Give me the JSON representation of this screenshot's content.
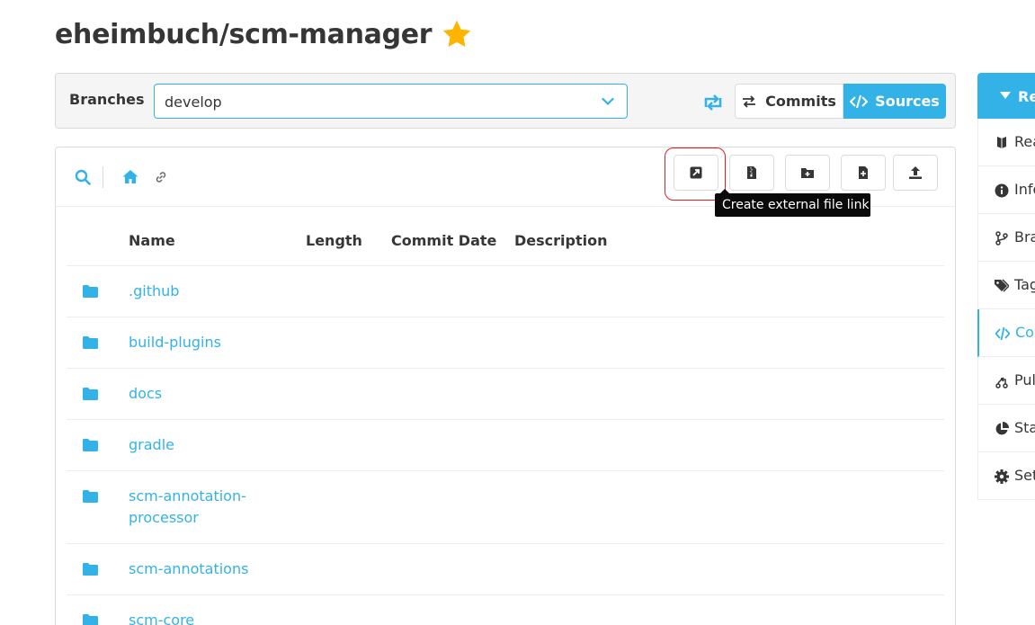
{
  "repo": {
    "title": "eheimbuch/scm-manager"
  },
  "branch_bar": {
    "label": "Branches",
    "selected_branch": "develop",
    "commits_label": "Commits",
    "sources_label": "Sources"
  },
  "toolbar": {
    "tooltip": "Create external file link"
  },
  "table": {
    "headers": [
      "Name",
      "Length",
      "Commit Date",
      "Description"
    ],
    "rows": [
      {
        "name": ".github"
      },
      {
        "name": "build-plugins"
      },
      {
        "name": "docs"
      },
      {
        "name": "gradle"
      },
      {
        "name": "scm-annotation-processor"
      },
      {
        "name": "scm-annotations"
      },
      {
        "name": "scm-core"
      }
    ]
  },
  "sidebar": {
    "header": "Re",
    "items": [
      {
        "label": "Rea",
        "icon": "readme-icon"
      },
      {
        "label": "Info",
        "icon": "info-icon"
      },
      {
        "label": "Bra",
        "icon": "branch-icon"
      },
      {
        "label": "Tag",
        "icon": "tags-icon"
      },
      {
        "label": "Coo",
        "icon": "code-icon",
        "active": true
      },
      {
        "label": "Pul",
        "icon": "pull-request-icon"
      },
      {
        "label": "Sta",
        "icon": "statistics-icon"
      },
      {
        "label": "Set",
        "icon": "settings-icon"
      }
    ]
  },
  "colors": {
    "accent": "#33b2e8",
    "star": "#ffb400",
    "highlight": "#e02020"
  }
}
